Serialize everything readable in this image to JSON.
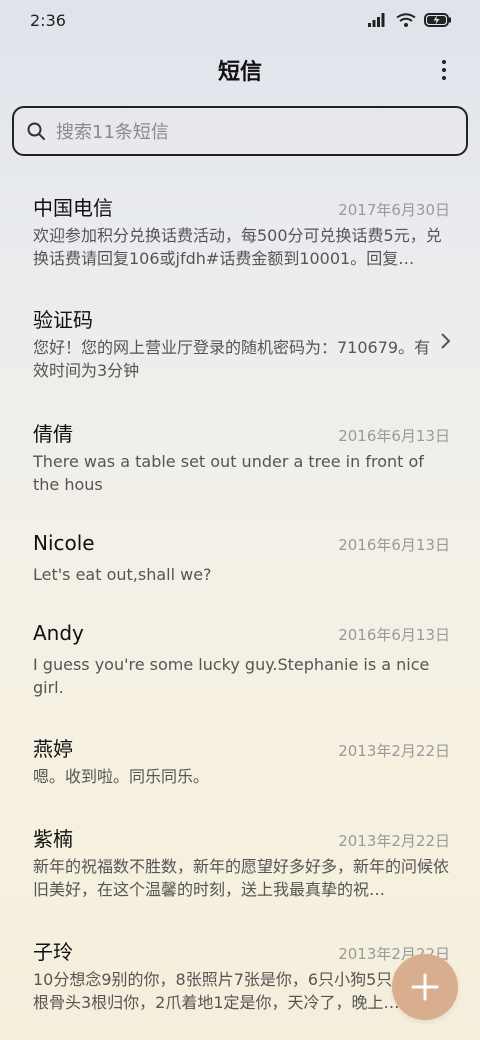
{
  "status": {
    "time": "2:36"
  },
  "header": {
    "title": "短信"
  },
  "search": {
    "placeholder": "搜索11条短信"
  },
  "messages": [
    {
      "name": "中国电信",
      "date": "2017年6月30日",
      "preview": "欢迎参加积分兑换话费活动，每500分可兑换话费5元，兑换话费请回复106或jfdh#话费金额到10001。回复…"
    },
    {
      "name": "验证码",
      "date": "",
      "preview": "您好！您的网上营业厅登录的随机密码为：710679。有效时间为3分钟"
    },
    {
      "name": "倩倩",
      "date": "2016年6月13日",
      "preview": "There was a table set out under a tree in front of the hous"
    },
    {
      "name": "Nicole",
      "date": "2016年6月13日",
      "preview": "Let's eat out,shall we?"
    },
    {
      "name": "Andy",
      "date": "2016年6月13日",
      "preview": "I guess you're some lucky guy.Stephanie is a nice girl."
    },
    {
      "name": "燕婷",
      "date": "2013年2月22日",
      "preview": "嗯。收到啦。同乐同乐。"
    },
    {
      "name": "紫楠",
      "date": "2013年2月22日",
      "preview": "新年的祝福数不胜数，新年的愿望好多好多，新年的问候依旧美好，在这个温馨的时刻，送上我最真挚的祝…"
    },
    {
      "name": "子玲",
      "date": "2013年2月22日",
      "preview": "10分想念9别的你，8张照片7张是你，6只小狗5只是你，4根骨头3根归你，2爪着地1定是你，天冷了，晚上…"
    }
  ],
  "icons": {
    "search": "search-icon",
    "more": "more-vert-icon",
    "chevron": "chevron-right-icon",
    "add": "plus-icon"
  },
  "colors": {
    "fab": "#d9ae8f"
  }
}
